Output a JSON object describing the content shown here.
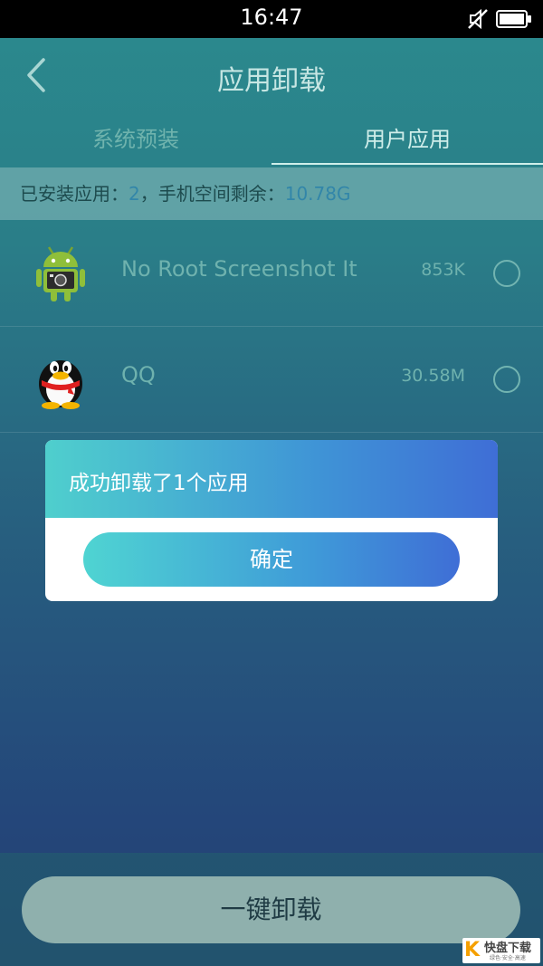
{
  "status_bar": {
    "time": "16:47",
    "icons": [
      "mute-icon",
      "battery-icon"
    ]
  },
  "header": {
    "back_icon": "chevron-left-icon",
    "title": "应用卸载"
  },
  "tabs": [
    {
      "label": "系统预装",
      "selected": false
    },
    {
      "label": "用户应用",
      "selected": true
    }
  ],
  "info_bar": {
    "installed_label": "已安装应用：",
    "installed_count": "2",
    "separator": "，手机空间剩余：",
    "free_space": "10.78G"
  },
  "apps": [
    {
      "name": "No Root Screenshot It",
      "size": "853K",
      "icon": "android-icon",
      "selected": false
    },
    {
      "name": "QQ",
      "size": "30.58M",
      "icon": "qq-penguin-icon",
      "selected": false
    }
  ],
  "dialog": {
    "message": "成功卸载了1个应用",
    "confirm_label": "确定"
  },
  "bottom": {
    "uninstall_all_label": "一键卸载"
  },
  "watermark": {
    "logo_text": "K",
    "brand": "快盘下载",
    "tagline": "绿色·安全·高速"
  },
  "colors": {
    "accent_start": "#4fcfcd",
    "accent_end": "#3f6ed6",
    "info_value": "#3286a9"
  }
}
